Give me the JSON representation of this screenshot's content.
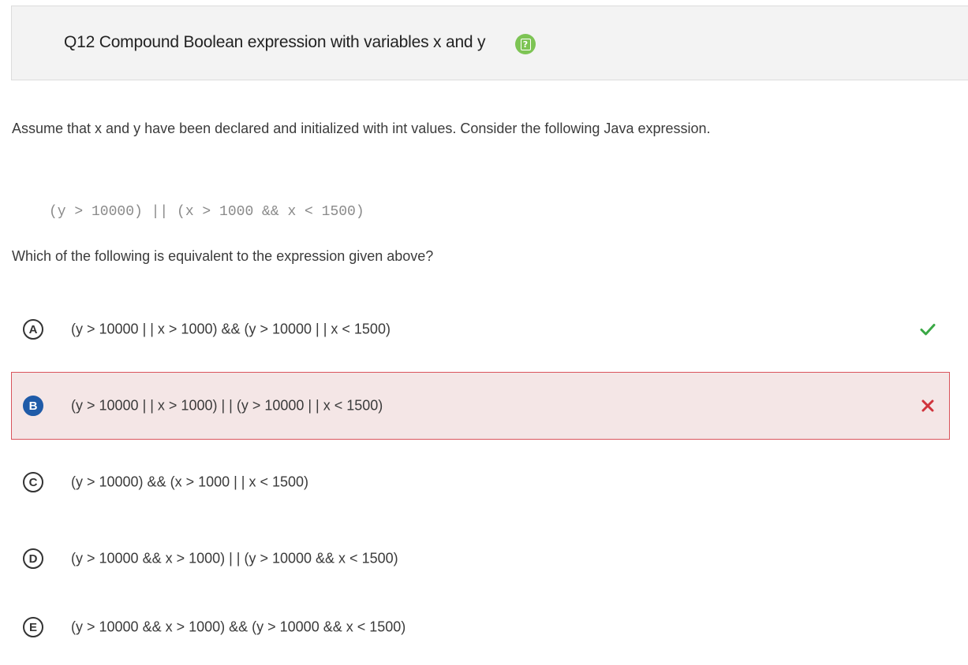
{
  "header": {
    "title": "Q12 Compound Boolean expression with variables x and y",
    "help_icon": "question-clipboard-icon",
    "help_icon_color": "#7dc454"
  },
  "prompt": "Assume that x and y have been declared and initialized with int values. Consider the following Java expression.",
  "code": "(y > 10000) || (x > 1000 && x < 1500)",
  "question": "Which of the following is equivalent to the expression given above?",
  "choices": [
    {
      "letter": "A",
      "text": "(y > 10000 | | x > 1000) && (y > 10000 | | x < 1500)",
      "status": "correct"
    },
    {
      "letter": "B",
      "text": "(y > 10000 | | x > 1000) | | (y > 10000 | | x < 1500)",
      "status": "selected-incorrect"
    },
    {
      "letter": "C",
      "text": "(y > 10000) && (x > 1000 | | x < 1500)",
      "status": "none"
    },
    {
      "letter": "D",
      "text": "(y > 10000 && x > 1000) | | (y > 10000 && x < 1500)",
      "status": "none"
    },
    {
      "letter": "E",
      "text": "(y > 10000 && x > 1000) && (y > 10000 && x < 1500)",
      "status": "none"
    }
  ],
  "colors": {
    "correct_mark": "#3aa845",
    "incorrect_mark": "#d0333c",
    "selected_bg": "#f4e6e6",
    "selected_border": "#d9535b",
    "selected_letter": "#1f5ba8"
  }
}
